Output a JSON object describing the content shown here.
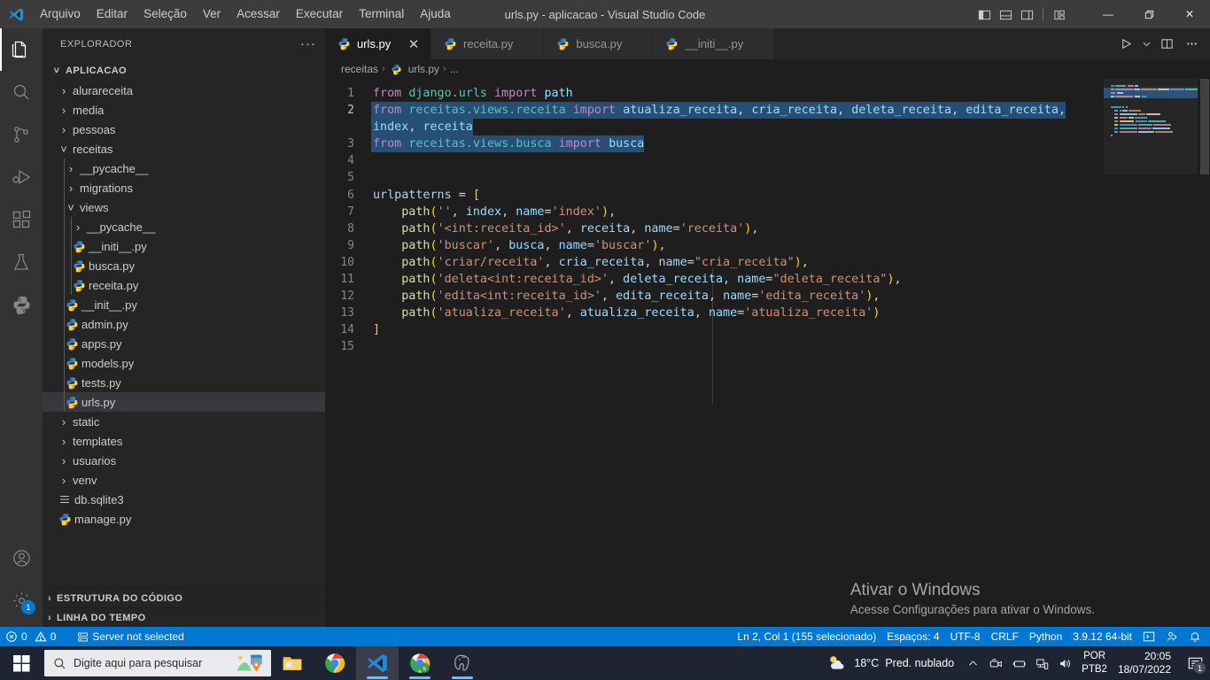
{
  "window": {
    "title": "urls.py - aplicacao - Visual Studio Code",
    "menu": [
      "Arquivo",
      "Editar",
      "Seleção",
      "Ver",
      "Acessar",
      "Executar",
      "Terminal",
      "Ajuda"
    ],
    "controls": {
      "minimize": "—",
      "maximize": "❐",
      "close": "✕"
    },
    "layout_toggles": [
      "toggle-primary-sidebar",
      "toggle-panel",
      "toggle-secondary-sidebar",
      "customize-layout"
    ]
  },
  "activity_bar": {
    "items": [
      {
        "name": "explorer",
        "icon": "files-icon",
        "active": true
      },
      {
        "name": "search",
        "icon": "search-icon",
        "active": false
      },
      {
        "name": "source-control",
        "icon": "source-control-icon",
        "active": false
      },
      {
        "name": "run-debug",
        "icon": "run-debug-icon",
        "active": false
      },
      {
        "name": "extensions",
        "icon": "extensions-icon",
        "active": false
      },
      {
        "name": "testing",
        "icon": "beaker-icon",
        "active": false
      },
      {
        "name": "python",
        "icon": "python-icon",
        "active": false
      }
    ],
    "bottom": [
      {
        "name": "accounts",
        "icon": "account-icon"
      },
      {
        "name": "manage",
        "icon": "gear-icon",
        "badge": "1"
      }
    ]
  },
  "sidebar": {
    "header": "EXPLORADOR",
    "more_actions": "···",
    "root": {
      "label": "APLICACAO",
      "expanded": true
    },
    "tree": [
      {
        "label": "alurareceita",
        "type": "folder",
        "expanded": false,
        "indent": 1
      },
      {
        "label": "media",
        "type": "folder",
        "expanded": false,
        "indent": 1
      },
      {
        "label": "pessoas",
        "type": "folder",
        "expanded": false,
        "indent": 1
      },
      {
        "label": "receitas",
        "type": "folder",
        "expanded": true,
        "indent": 1
      },
      {
        "label": "__pycache__",
        "type": "folder",
        "expanded": false,
        "indent": 2
      },
      {
        "label": "migrations",
        "type": "folder",
        "expanded": false,
        "indent": 2
      },
      {
        "label": "views",
        "type": "folder",
        "expanded": true,
        "indent": 2
      },
      {
        "label": "__pycache__",
        "type": "folder",
        "expanded": false,
        "indent": 3
      },
      {
        "label": "__initi__.py",
        "type": "python",
        "indent": 3
      },
      {
        "label": "busca.py",
        "type": "python",
        "indent": 3
      },
      {
        "label": "receita.py",
        "type": "python",
        "indent": 3
      },
      {
        "label": "__init__.py",
        "type": "python",
        "indent": 2
      },
      {
        "label": "admin.py",
        "type": "python",
        "indent": 2
      },
      {
        "label": "apps.py",
        "type": "python",
        "indent": 2
      },
      {
        "label": "models.py",
        "type": "python",
        "indent": 2
      },
      {
        "label": "tests.py",
        "type": "python",
        "indent": 2
      },
      {
        "label": "urls.py",
        "type": "python",
        "indent": 2,
        "selected": true
      },
      {
        "label": "static",
        "type": "folder",
        "expanded": false,
        "indent": 1
      },
      {
        "label": "templates",
        "type": "folder",
        "expanded": false,
        "indent": 1
      },
      {
        "label": "usuarios",
        "type": "folder",
        "expanded": false,
        "indent": 1
      },
      {
        "label": "venv",
        "type": "folder",
        "expanded": false,
        "indent": 1
      },
      {
        "label": "db.sqlite3",
        "type": "database",
        "indent": 1
      },
      {
        "label": "manage.py",
        "type": "python",
        "indent": 1
      }
    ],
    "panels": [
      {
        "label": "ESTRUTURA DO CÓDIGO",
        "expanded": false
      },
      {
        "label": "LINHA DO TEMPO",
        "expanded": false
      }
    ]
  },
  "editor": {
    "tabs": [
      {
        "label": "urls.py",
        "icon": "python-icon",
        "active": true,
        "closable": true
      },
      {
        "label": "receita.py",
        "icon": "python-icon",
        "active": false
      },
      {
        "label": "busca.py",
        "icon": "python-icon",
        "active": false
      },
      {
        "label": "__initi__.py",
        "icon": "python-icon",
        "active": false
      }
    ],
    "tab_actions": [
      "run-python-file-icon",
      "chevron-down-icon",
      "split-editor-icon",
      "more-actions-icon"
    ],
    "close_glyph": "✕",
    "breadcrumb": [
      "receitas",
      "urls.py",
      "..."
    ],
    "code_lines": [
      {
        "n": "1",
        "text": "from django.urls import path"
      },
      {
        "n": "2",
        "text": "from receitas.views.receita import atualiza_receita, cria_receita, deleta_receita, edita_receita,"
      },
      {
        "n": "",
        "text": "index, receita"
      },
      {
        "n": "3",
        "text": "from receitas.views.busca import busca"
      },
      {
        "n": "4",
        "text": ""
      },
      {
        "n": "5",
        "text": ""
      },
      {
        "n": "6",
        "text": "urlpatterns = ["
      },
      {
        "n": "7",
        "text": "    path('', index, name='index'),"
      },
      {
        "n": "8",
        "text": "    path('<int:receita_id>', receita, name='receita'),"
      },
      {
        "n": "9",
        "text": "    path('buscar', busca, name='buscar'),"
      },
      {
        "n": "10",
        "text": "    path('criar/receita', cria_receita, name=\"cria_receita\"),"
      },
      {
        "n": "11",
        "text": "    path('deleta<int:receita_id>', deleta_receita, name=\"deleta_receita\"),"
      },
      {
        "n": "12",
        "text": "    path('edita<int:receita_id>', edita_receita, name='edita_receita'),"
      },
      {
        "n": "13",
        "text": "    path('atualiza_receita', atualiza_receita, name='atualiza_receita')"
      },
      {
        "n": "14",
        "text": "]"
      },
      {
        "n": "15",
        "text": ""
      }
    ],
    "watermark": {
      "title": "Ativar o Windows",
      "subtitle": "Acesse Configurações para ativar o Windows."
    }
  },
  "status_bar": {
    "errors": "0",
    "warnings": "0",
    "server": "Server not selected",
    "cursor": "Ln 2, Col 1 (155 selecionado)",
    "indentation": "Espaços: 4",
    "encoding": "UTF-8",
    "eol": "CRLF",
    "language": "Python",
    "interpreter": "3.9.12 64-bit",
    "right_icons": [
      "open-terminal-icon",
      "live-share-icon",
      "notifications-bell-icon"
    ],
    "background": "#0078d4"
  },
  "taskbar": {
    "search_placeholder": "Digite aqui para pesquisar",
    "apps": [
      {
        "name": "file-explorer",
        "icon": "folder-icon"
      },
      {
        "name": "google-chrome",
        "icon": "chrome-icon"
      },
      {
        "name": "visual-studio-code",
        "icon": "vscode-icon",
        "running": true,
        "focused": true
      },
      {
        "name": "chrome-profile",
        "icon": "chrome-s-icon",
        "running": true
      },
      {
        "name": "postgresql",
        "icon": "elephant-icon",
        "running": true
      }
    ],
    "weather": {
      "temperature": "18°C",
      "condition": "Pred. nublado"
    },
    "tray_icons": [
      "chevron-up-icon",
      "meet-now-icon",
      "battery-icon",
      "network-icon",
      "volume-icon"
    ],
    "language": {
      "line1": "POR",
      "line2": "PTB2"
    },
    "clock": {
      "time": "20:05",
      "date": "18/07/2022"
    },
    "notifications": {
      "count": "1"
    }
  }
}
